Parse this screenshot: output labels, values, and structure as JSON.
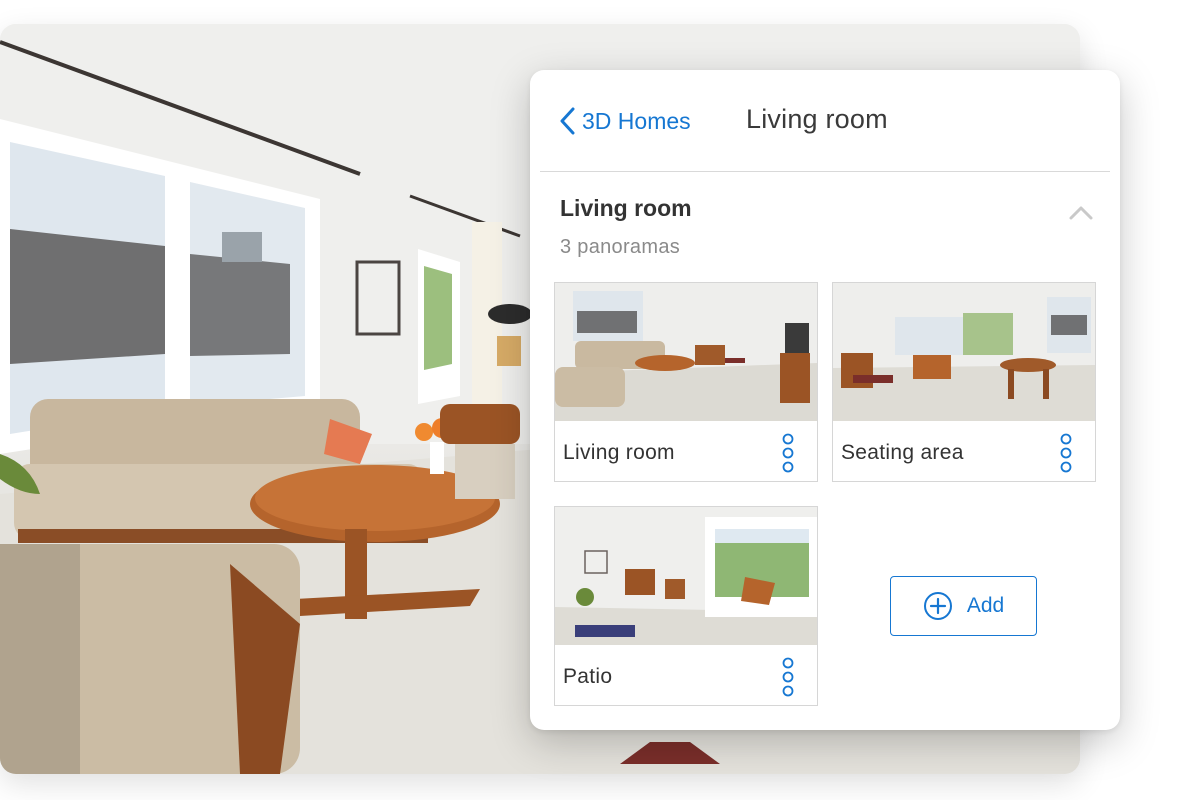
{
  "header": {
    "back_label": "3D Homes",
    "title": "Living room"
  },
  "section": {
    "title": "Living room",
    "subtitle": "3 panoramas"
  },
  "panoramas": [
    {
      "label": "Living room"
    },
    {
      "label": "Seating area"
    },
    {
      "label": "Patio"
    }
  ],
  "add_label": "Add",
  "icons": {
    "back": "chevron-left-icon",
    "collapse": "chevron-up-icon",
    "more": "more-vertical-icon",
    "add": "plus-circle-icon"
  },
  "colors": {
    "accent": "#1677d2",
    "text": "#333333",
    "muted": "#8a8a8a"
  }
}
